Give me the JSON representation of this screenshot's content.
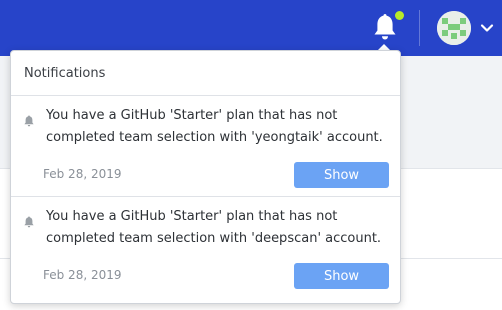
{
  "topbar": {
    "bg_color": "#2744c9",
    "bell_icon": "bell-icon",
    "has_unread": true,
    "unread_dot_color": "#b7ea2a",
    "avatar_icon": "pixel-avatar",
    "menu_icon": "chevron-down-icon"
  },
  "notifications_panel": {
    "title": "Notifications",
    "items": [
      {
        "icon": "bell-icon",
        "message": "You have a GitHub 'Starter' plan that has not completed team selection with 'yeongtaik' account.",
        "date": "Feb 28, 2019",
        "action_label": "Show"
      },
      {
        "icon": "bell-icon",
        "message": "You have a GitHub 'Starter' plan that has not completed team selection with 'deepscan' account.",
        "date": "Feb 28, 2019",
        "action_label": "Show"
      }
    ],
    "action_button_color": "#6ba3f4"
  }
}
